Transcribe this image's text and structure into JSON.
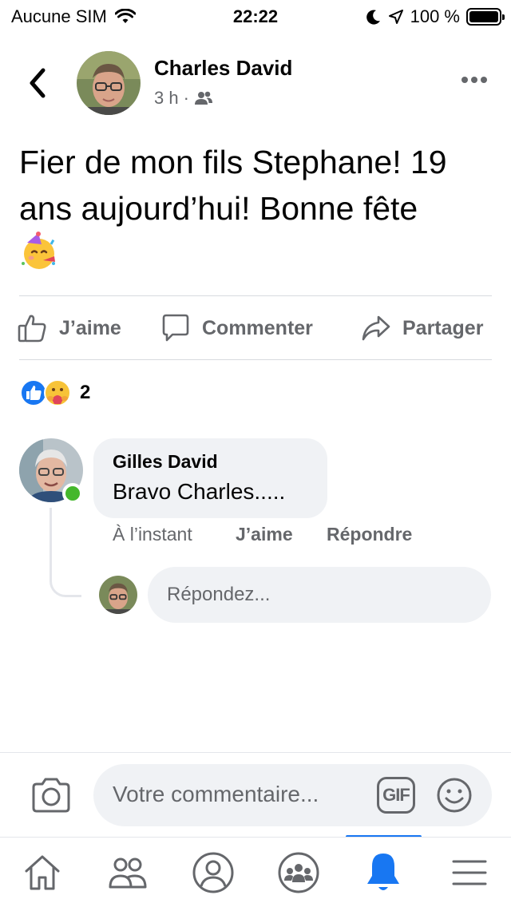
{
  "status_bar": {
    "carrier": "Aucune SIM",
    "time": "22:22",
    "battery": "100 %"
  },
  "post": {
    "author": "Charles David",
    "time_ago": "3 h",
    "separator": "·",
    "audience_icon": "friends-icon",
    "text": "Fier de mon fils Stephane! 19 ans aujourd’hui! Bonne fête",
    "emoji": "partying-face-icon"
  },
  "actions": {
    "like": "J’aime",
    "comment": "Commenter",
    "share": "Partager"
  },
  "reactions": {
    "icons": [
      "like-reaction-icon",
      "care-reaction-icon"
    ],
    "count": "2"
  },
  "comment": {
    "author": "Gilles David",
    "text": "Bravo Charles.....",
    "time": "À l’instant",
    "like": "J’aime",
    "reply": "Répondre",
    "online": true
  },
  "reply_field": {
    "placeholder": "Répondez..."
  },
  "composer": {
    "placeholder": "Votre commentaire...",
    "gif_label": "GIF"
  },
  "tabbar": {
    "items": [
      "home-icon",
      "friends-icon",
      "profile-icon",
      "groups-icon",
      "notifications-icon",
      "menu-icon"
    ],
    "active": "notifications-icon",
    "active_color": "#1877f2"
  },
  "colors": {
    "secondary_text": "#65676b",
    "bubble_bg": "#f0f2f5",
    "online": "#44b72c",
    "accent": "#1877f2"
  }
}
